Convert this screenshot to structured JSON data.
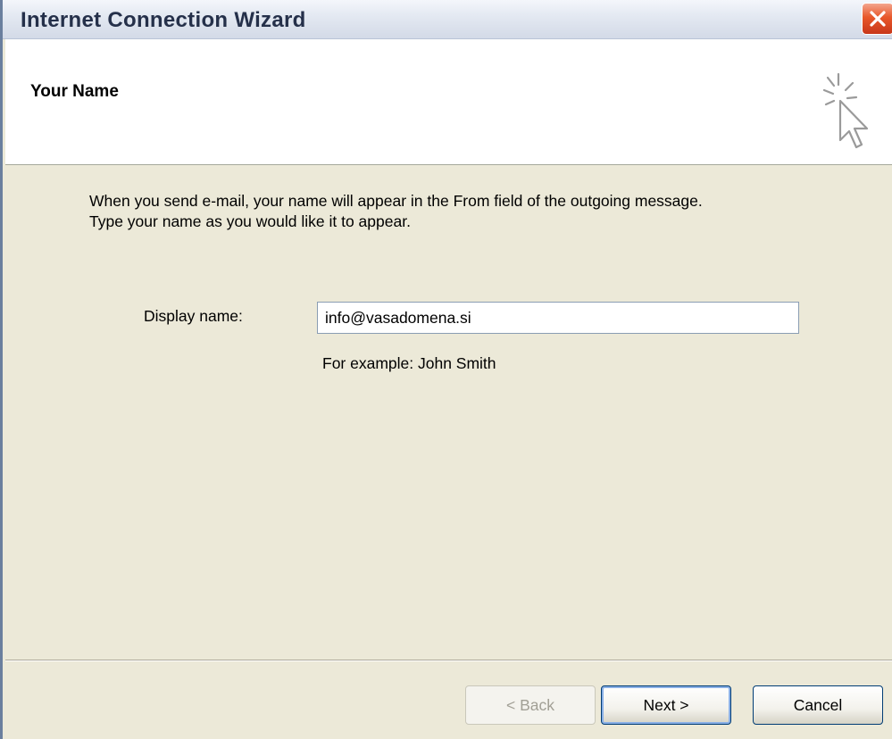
{
  "window": {
    "title": "Internet Connection Wizard",
    "accent_color": "#e8582a"
  },
  "header": {
    "title": "Your Name",
    "icon": "cursor-sparkle-icon"
  },
  "content": {
    "description_line1": "When you send e-mail, your name will appear in the From field of the outgoing message.",
    "description_line2": "Type your name as you would like it to appear.",
    "display_name_label": "Display name:",
    "display_name_value": "info@vasadomena.si",
    "example_text": "For example: John Smith"
  },
  "buttons": {
    "back": "< Back",
    "next": "Next >",
    "cancel": "Cancel"
  }
}
